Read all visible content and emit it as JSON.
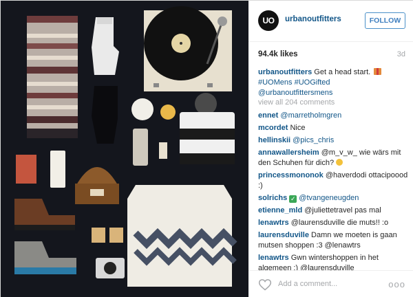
{
  "post": {
    "photo_alt": "flat lay of winter accessories",
    "account": {
      "avatar_text": "UO",
      "username": "urbanoutfitters",
      "follow_label": "FOLLOW"
    },
    "likes": "94.4k likes",
    "age": "3d",
    "caption": {
      "user": "urbanoutfitters",
      "text": " Get a head start. ",
      "gift_icon": "gift-icon",
      "tags": "#UOMens #UOGifted",
      "mention": "@urbanoutfittersmens"
    },
    "view_all": "view all 204 comments",
    "comments": [
      {
        "user": "ennet",
        "text": "@marretholmgren"
      },
      {
        "user": "mcordet",
        "text": "Nice"
      },
      {
        "user": "hellinskii",
        "text": "@pics_chris"
      },
      {
        "user": "annawallersheim",
        "text": "@m_v_w_ wie wärs mit den Schuhen für dich? ",
        "icon": "smile-icon"
      },
      {
        "user": "princessmononok",
        "text": "@haverdodi ottacipoood :)"
      },
      {
        "user": "solrichs",
        "text": " @tvangeneugden",
        "icon_before": "check-icon"
      },
      {
        "user": "etienne_mld",
        "text": "@juliettetravel pas mal"
      },
      {
        "user": "lenawtrs",
        "text": "@laurensduville die muts!! :o"
      },
      {
        "user": "laurensduville",
        "text": "Damn we moeten is gaan mutsen shoppen :3 @lenawtrs"
      },
      {
        "user": "lenawtrs",
        "text": "Gwn wintershoppen in het algemeen :) @laurensduville"
      }
    ],
    "add_comment_placeholder": "Add a comment...",
    "more_label": "ooo",
    "colors": {
      "link": "#125688",
      "follow_border": "#4a90c8",
      "muted": "#a5a7aa",
      "photo_bg": "#14161d"
    }
  }
}
